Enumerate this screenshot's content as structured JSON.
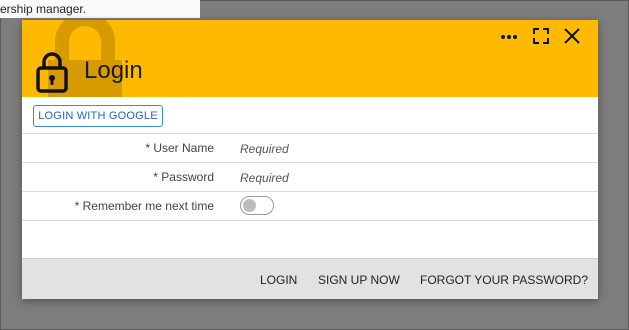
{
  "background": {
    "text": "ership manager."
  },
  "dialog": {
    "title": "Login",
    "header_color": "#ffba00",
    "icons": {
      "lock": "lock-icon",
      "more": "more-dots-icon",
      "fullscreen": "fullscreen-icon",
      "close": "close-icon"
    },
    "google_button": "LOGIN WITH GOOGLE",
    "fields": [
      {
        "label": "* User Name",
        "placeholder": "Required"
      },
      {
        "label": "* Password",
        "placeholder": "Required"
      }
    ],
    "remember": {
      "label": "* Remember me next time",
      "checked": false
    },
    "actions": {
      "login": "LOGIN",
      "signup": "SIGN UP NOW",
      "forgot": "FORGOT YOUR PASSWORD?"
    }
  }
}
